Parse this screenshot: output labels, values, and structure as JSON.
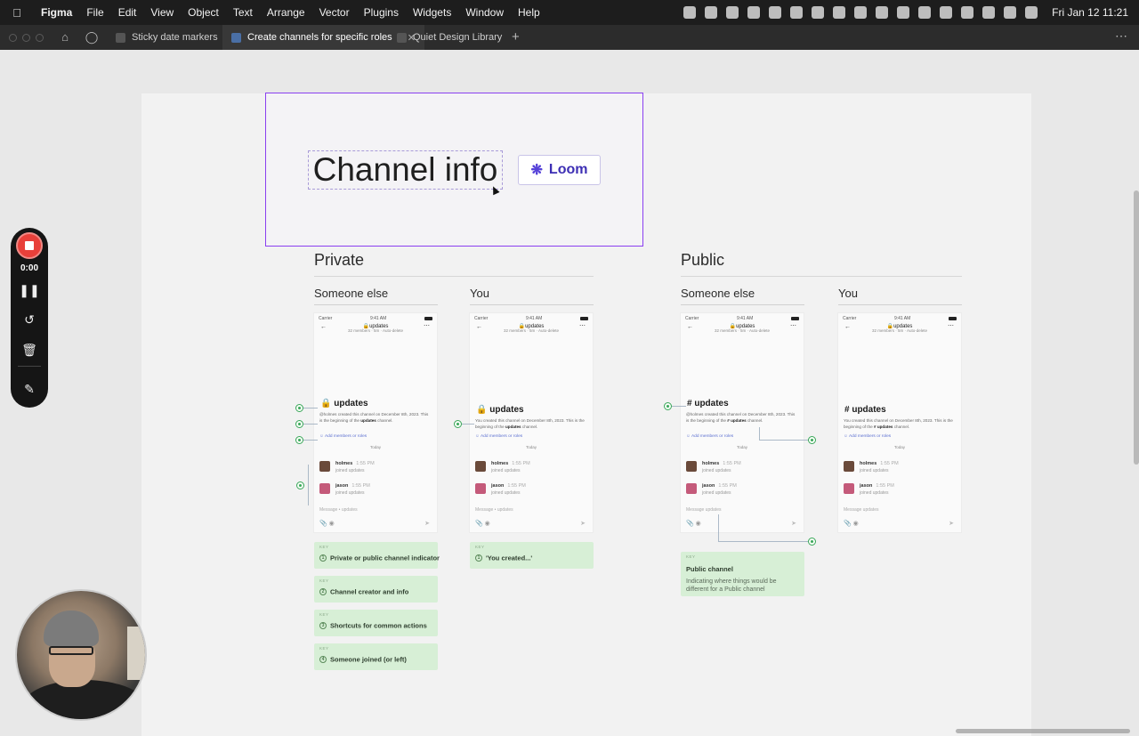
{
  "menubar": {
    "app": "Figma",
    "items": [
      "File",
      "Edit",
      "View",
      "Object",
      "Text",
      "Arrange",
      "Vector",
      "Plugins",
      "Widgets",
      "Window",
      "Help"
    ],
    "clock": "Fri Jan 12  11:21"
  },
  "tabs": [
    {
      "label": "Sticky date markers"
    },
    {
      "label": "Create channels for specific roles"
    },
    {
      "label": "Quiet Design Library"
    }
  ],
  "frame": {
    "title": "Channel info",
    "loom_label": "Loom"
  },
  "sections": {
    "private": "Private",
    "public": "Public",
    "someone_else": "Someone else",
    "you": "You"
  },
  "phone": {
    "carrier": "Carrier",
    "time": "9:41 AM",
    "channel": "updates",
    "meta": "32 members  ·  5m  ·  Auto-delete",
    "private_title": "updates",
    "public_title": "# updates",
    "desc_other": "@holmes created this channel on December 8th, 2023. This is the beginning of the",
    "desc_you": "You created this channel on December 8th, 2023. This is the beginning of the",
    "desc_chan_private": "updates",
    "desc_chan_public": "# updates",
    "desc_end": "channel.",
    "add": "Add members or roles",
    "today": "Today",
    "msgs": [
      {
        "name": "holmes",
        "time": "1:55 PM",
        "action": "joined updates"
      },
      {
        "name": "jason",
        "time": "1:55 PM",
        "action": "joined updates"
      }
    ],
    "msg_placeholder": "Message • updates",
    "msg_placeholder_public": "Message updates"
  },
  "cards": {
    "key": "KEY",
    "private_other": [
      {
        "n": "1",
        "label": "Private or public channel indicator"
      },
      {
        "n": "2",
        "label": "Channel creator and info"
      },
      {
        "n": "3",
        "label": "Shortcuts for common actions"
      },
      {
        "n": "4",
        "label": "Someone joined (or left)"
      }
    ],
    "private_you": {
      "n": "1",
      "label": "'You created...'"
    },
    "public": {
      "title": "Public channel",
      "body": "Indicating where things would be different for a Public channel"
    }
  },
  "recorder": {
    "time": "0:00"
  },
  "colors": {
    "accent": "#8a3ff0",
    "loom": "#3d2fb4",
    "record": "#e8403a",
    "note_green": "#d7efd6"
  }
}
